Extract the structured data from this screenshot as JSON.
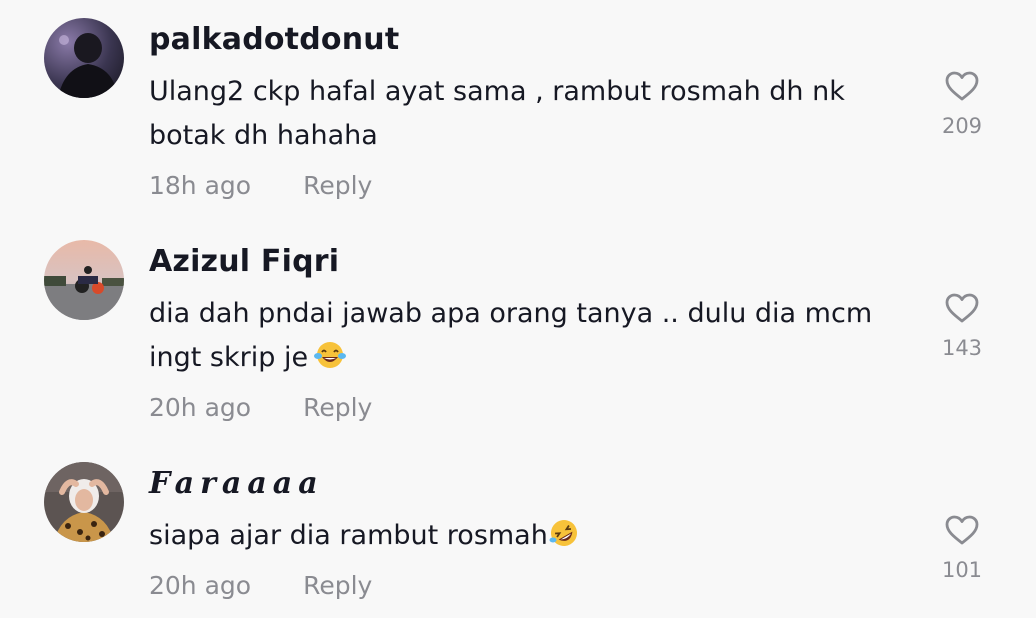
{
  "comments": [
    {
      "username": "palkadotdonut",
      "text": "Ulang2 ckp hafal ayat sama , rambut rosmah dh nk botak dh hahaha",
      "emoji": "",
      "time": "18h ago",
      "reply": "Reply",
      "likes": "209"
    },
    {
      "username": "Azizul Fiqri",
      "text": "dia dah pndai jawab apa orang tanya .. dulu dia mcm ingt skrip je",
      "emoji": "tears-of-joy-emoji",
      "time": "20h ago",
      "reply": "Reply",
      "likes": "143"
    },
    {
      "username": "Faraaaa",
      "text": "siapa ajar dia rambut rosmah",
      "emoji": "rolling-on-floor-laughing-emoji",
      "time": "20h ago",
      "reply": "Reply",
      "likes": "101"
    }
  ],
  "icons": {
    "like": "heart-outline-icon"
  },
  "colors": {
    "background": "#f8f8f8",
    "username": "#161823",
    "secondary_text": "#8a8b91"
  }
}
